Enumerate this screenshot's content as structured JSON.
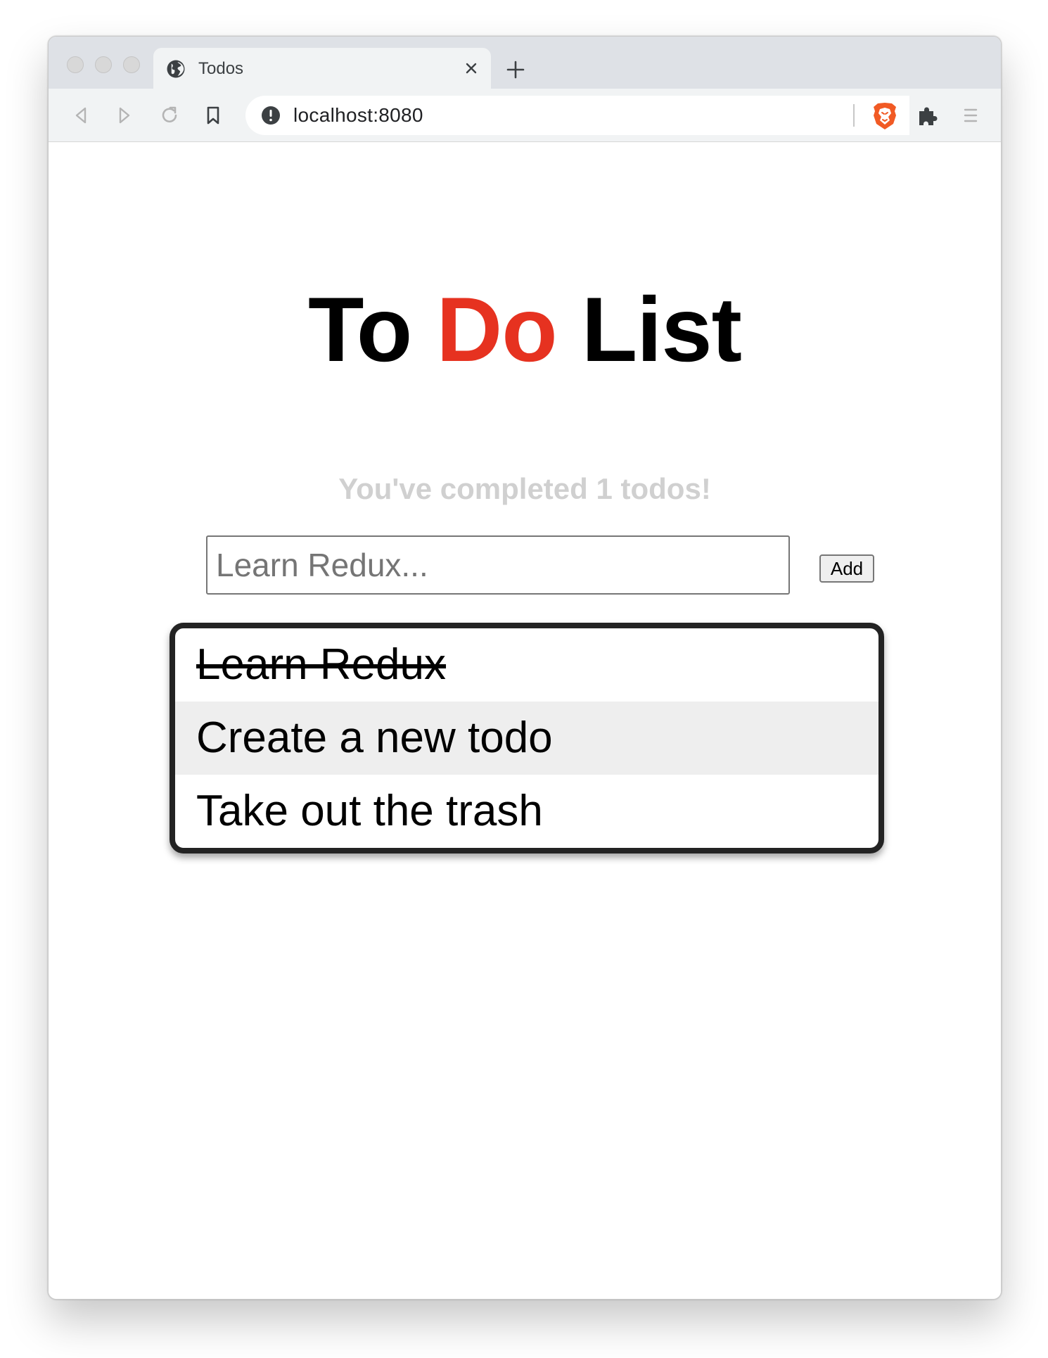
{
  "browser": {
    "tab_title": "Todos",
    "url": "localhost:8080",
    "icons": {
      "favicon": "globe-icon",
      "close": "close-icon",
      "new_tab": "plus-icon",
      "back": "back-arrow-icon",
      "forward": "forward-arrow-icon",
      "reload": "reload-icon",
      "bookmark": "bookmark-icon",
      "site_info": "info-icon",
      "brave_shields": "brave-lion-icon",
      "extensions": "puzzle-piece-icon",
      "menu": "hamburger-menu-icon"
    }
  },
  "page": {
    "title_parts": [
      "To ",
      "Do",
      " List"
    ],
    "accent_color": "#e63220",
    "completed_message": "You've completed 1 todos!",
    "input": {
      "placeholder": "Learn Redux...",
      "value": ""
    },
    "add_label": "Add",
    "todos": [
      {
        "text": "Learn Redux",
        "completed": true
      },
      {
        "text": "Create a new todo",
        "completed": false
      },
      {
        "text": "Take out the trash",
        "completed": false
      }
    ]
  }
}
